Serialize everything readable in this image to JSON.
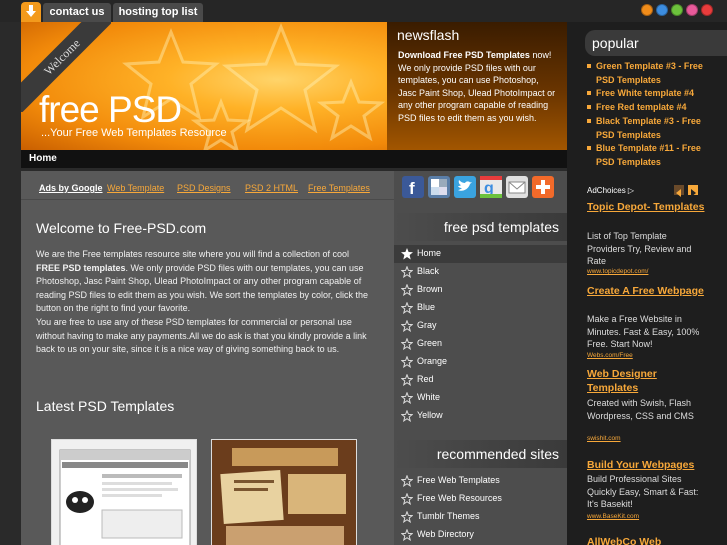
{
  "top_nav": {
    "contact": "contact us",
    "hosting": "hosting top list"
  },
  "header": {
    "ribbon": "Welcome",
    "title": "free PSD",
    "tagline": "...Your Free Web Templates Resource"
  },
  "newsflash": {
    "title": "newsflash",
    "lead": "Download Free PSD Templates",
    "text": " now! We only provide PSD files with our templates, you can use Photoshop, Jasc Paint Shop, Ulead PhotoImpact or any other program capable of reading PSD files to edit them as you wish."
  },
  "nav": {
    "home": "Home"
  },
  "ads": {
    "label": "Ads by Google",
    "links": [
      "Web Template",
      "PSD Designs",
      "PSD 2 HTML",
      "Free Templates"
    ]
  },
  "main": {
    "welcome_title": "Welcome to Free-PSD.com",
    "p1_a": "We are the Free templates resource site where you will find a collection of cool ",
    "p1_b": "FREE PSD templates",
    "p1_c": ". We only provide PSD files with our templates, you can use Photoshop, Jasc Paint Shop, Ulead PhotoImpact or any other program capable of reading PSD files to edit them as you wish. We sort the templates by color, click the button on the right to find your favorite.",
    "p2": "You are free to use any of these PSD templates for commercial or personal use without having to make any payments.All we do ask is that you kindly provide a link back to us on your site, since it is a nice way of giving something back to us.",
    "latest_title": "Latest PSD Templates"
  },
  "center": {
    "psd_head": "free psd templates",
    "colors": [
      "Home",
      "Black",
      "Brown",
      "Blue",
      "Gray",
      "Green",
      "Orange",
      "Red",
      "White",
      "Yellow"
    ],
    "rec_head": "recommended sites",
    "sites": [
      "Free Web Templates",
      "Free Web Resources",
      "Tumblr Themes",
      "Web Directory"
    ]
  },
  "right": {
    "popular_head": "popular",
    "popular": [
      "Green Template #3 - Free PSD Templates",
      "Free White template #4",
      "Free Red template #4",
      "Black Template #3 - Free PSD Templates",
      "Blue Template #11 - Free PSD Templates"
    ],
    "adchoices": "AdChoices",
    "ad1": {
      "title": "Topic Depot- Templates",
      "body": "List of Top Template Providers Try, Review and Rate",
      "url": "www.topicdepot.com/"
    },
    "ad2": {
      "title": "Create A Free Webpage",
      "body": "Make a Free Website in Minutes. Fast & Easy, 100% Free. Start Now!",
      "url": "Webs.com/Free"
    },
    "ad3": {
      "title": "Web Designer Templates",
      "body": "Created with Swish, Flash Wordpress, CSS and CMS",
      "url": "swishit.com"
    },
    "ad4": {
      "title": "Build Your Webpages",
      "body": "Build Professional Sites Quickly Easy, Smart & Fast: It's Basekit!",
      "url": "www.BaseKit.com"
    },
    "ad5": {
      "title": "AllWebCo Web"
    }
  },
  "colors": {
    "accent": "#f7a83a",
    "dots": [
      "#f08c1a",
      "#3c8de0",
      "#6cc23c",
      "#e85a9a",
      "#e83c3c"
    ]
  }
}
